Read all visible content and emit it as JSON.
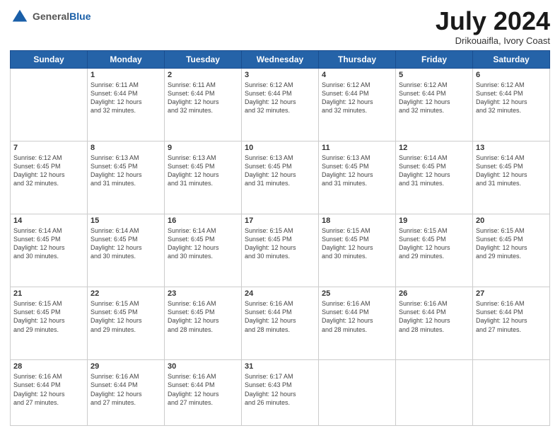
{
  "header": {
    "logo_general": "General",
    "logo_blue": "Blue",
    "month_title": "July 2024",
    "location": "Drikouaifla, Ivory Coast"
  },
  "days_of_week": [
    "Sunday",
    "Monday",
    "Tuesday",
    "Wednesday",
    "Thursday",
    "Friday",
    "Saturday"
  ],
  "weeks": [
    [
      {
        "day": "",
        "info": ""
      },
      {
        "day": "1",
        "info": "Sunrise: 6:11 AM\nSunset: 6:44 PM\nDaylight: 12 hours\nand 32 minutes."
      },
      {
        "day": "2",
        "info": "Sunrise: 6:11 AM\nSunset: 6:44 PM\nDaylight: 12 hours\nand 32 minutes."
      },
      {
        "day": "3",
        "info": "Sunrise: 6:12 AM\nSunset: 6:44 PM\nDaylight: 12 hours\nand 32 minutes."
      },
      {
        "day": "4",
        "info": "Sunrise: 6:12 AM\nSunset: 6:44 PM\nDaylight: 12 hours\nand 32 minutes."
      },
      {
        "day": "5",
        "info": "Sunrise: 6:12 AM\nSunset: 6:44 PM\nDaylight: 12 hours\nand 32 minutes."
      },
      {
        "day": "6",
        "info": "Sunrise: 6:12 AM\nSunset: 6:44 PM\nDaylight: 12 hours\nand 32 minutes."
      }
    ],
    [
      {
        "day": "7",
        "info": "Sunrise: 6:12 AM\nSunset: 6:45 PM\nDaylight: 12 hours\nand 32 minutes."
      },
      {
        "day": "8",
        "info": "Sunrise: 6:13 AM\nSunset: 6:45 PM\nDaylight: 12 hours\nand 31 minutes."
      },
      {
        "day": "9",
        "info": "Sunrise: 6:13 AM\nSunset: 6:45 PM\nDaylight: 12 hours\nand 31 minutes."
      },
      {
        "day": "10",
        "info": "Sunrise: 6:13 AM\nSunset: 6:45 PM\nDaylight: 12 hours\nand 31 minutes."
      },
      {
        "day": "11",
        "info": "Sunrise: 6:13 AM\nSunset: 6:45 PM\nDaylight: 12 hours\nand 31 minutes."
      },
      {
        "day": "12",
        "info": "Sunrise: 6:14 AM\nSunset: 6:45 PM\nDaylight: 12 hours\nand 31 minutes."
      },
      {
        "day": "13",
        "info": "Sunrise: 6:14 AM\nSunset: 6:45 PM\nDaylight: 12 hours\nand 31 minutes."
      }
    ],
    [
      {
        "day": "14",
        "info": "Sunrise: 6:14 AM\nSunset: 6:45 PM\nDaylight: 12 hours\nand 30 minutes."
      },
      {
        "day": "15",
        "info": "Sunrise: 6:14 AM\nSunset: 6:45 PM\nDaylight: 12 hours\nand 30 minutes."
      },
      {
        "day": "16",
        "info": "Sunrise: 6:14 AM\nSunset: 6:45 PM\nDaylight: 12 hours\nand 30 minutes."
      },
      {
        "day": "17",
        "info": "Sunrise: 6:15 AM\nSunset: 6:45 PM\nDaylight: 12 hours\nand 30 minutes."
      },
      {
        "day": "18",
        "info": "Sunrise: 6:15 AM\nSunset: 6:45 PM\nDaylight: 12 hours\nand 30 minutes."
      },
      {
        "day": "19",
        "info": "Sunrise: 6:15 AM\nSunset: 6:45 PM\nDaylight: 12 hours\nand 29 minutes."
      },
      {
        "day": "20",
        "info": "Sunrise: 6:15 AM\nSunset: 6:45 PM\nDaylight: 12 hours\nand 29 minutes."
      }
    ],
    [
      {
        "day": "21",
        "info": "Sunrise: 6:15 AM\nSunset: 6:45 PM\nDaylight: 12 hours\nand 29 minutes."
      },
      {
        "day": "22",
        "info": "Sunrise: 6:15 AM\nSunset: 6:45 PM\nDaylight: 12 hours\nand 29 minutes."
      },
      {
        "day": "23",
        "info": "Sunrise: 6:16 AM\nSunset: 6:45 PM\nDaylight: 12 hours\nand 28 minutes."
      },
      {
        "day": "24",
        "info": "Sunrise: 6:16 AM\nSunset: 6:44 PM\nDaylight: 12 hours\nand 28 minutes."
      },
      {
        "day": "25",
        "info": "Sunrise: 6:16 AM\nSunset: 6:44 PM\nDaylight: 12 hours\nand 28 minutes."
      },
      {
        "day": "26",
        "info": "Sunrise: 6:16 AM\nSunset: 6:44 PM\nDaylight: 12 hours\nand 28 minutes."
      },
      {
        "day": "27",
        "info": "Sunrise: 6:16 AM\nSunset: 6:44 PM\nDaylight: 12 hours\nand 27 minutes."
      }
    ],
    [
      {
        "day": "28",
        "info": "Sunrise: 6:16 AM\nSunset: 6:44 PM\nDaylight: 12 hours\nand 27 minutes."
      },
      {
        "day": "29",
        "info": "Sunrise: 6:16 AM\nSunset: 6:44 PM\nDaylight: 12 hours\nand 27 minutes."
      },
      {
        "day": "30",
        "info": "Sunrise: 6:16 AM\nSunset: 6:44 PM\nDaylight: 12 hours\nand 27 minutes."
      },
      {
        "day": "31",
        "info": "Sunrise: 6:17 AM\nSunset: 6:43 PM\nDaylight: 12 hours\nand 26 minutes."
      },
      {
        "day": "",
        "info": ""
      },
      {
        "day": "",
        "info": ""
      },
      {
        "day": "",
        "info": ""
      }
    ]
  ]
}
